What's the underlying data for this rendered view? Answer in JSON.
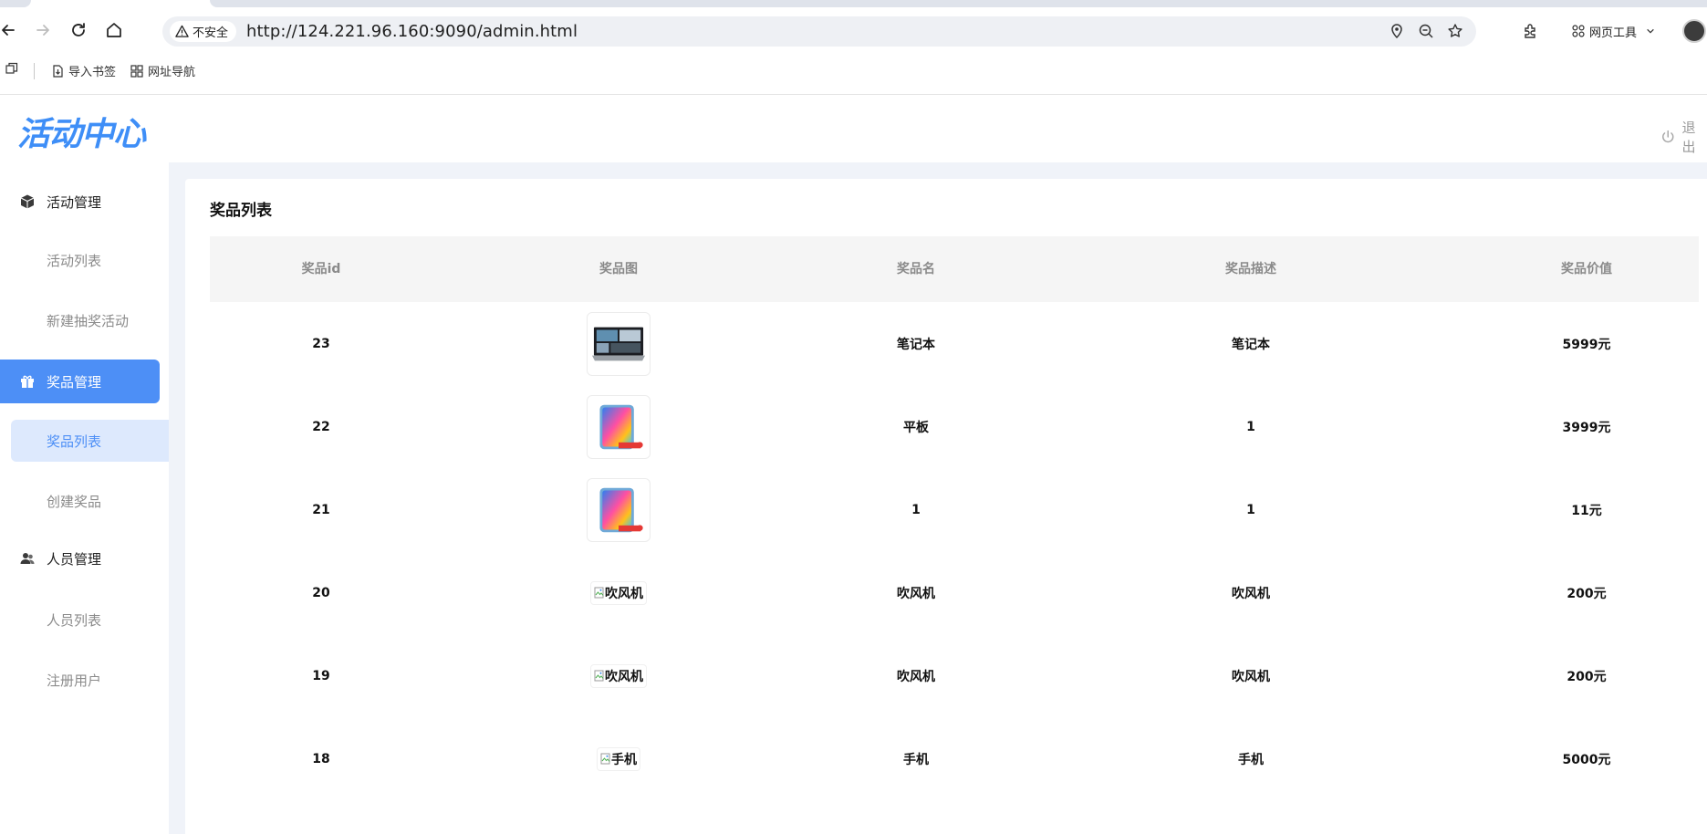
{
  "browser": {
    "security_label": "不安全",
    "url": "http://124.221.96.160:9090/admin.html",
    "web_tools_label": "网页工具",
    "bookmarks": [
      {
        "label": "导入书签",
        "icon": "import-bookmark-icon"
      },
      {
        "label": "网址导航",
        "icon": "grid-icon"
      }
    ]
  },
  "app": {
    "logo_text": "活动中心",
    "logout_label": "退出",
    "accent_color": "#4d8ff6"
  },
  "sidebar": {
    "groups": [
      {
        "label": "活动管理",
        "icon": "cube-icon",
        "items": [
          "活动列表",
          "新建抽奖活动"
        ]
      },
      {
        "label": "奖品管理",
        "icon": "gift-icon",
        "items": [
          "奖品列表",
          "创建奖品"
        ]
      },
      {
        "label": "人员管理",
        "icon": "users-icon",
        "items": [
          "人员列表",
          "注册用户"
        ]
      }
    ],
    "active_group": "奖品管理",
    "active_item": "奖品列表"
  },
  "page": {
    "title": "奖品列表"
  },
  "table": {
    "columns": [
      "奖品id",
      "奖品图",
      "奖品名",
      "奖品描述",
      "奖品价值"
    ],
    "rows": [
      {
        "id": "23",
        "image": "laptop",
        "image_alt": "",
        "name": "笔记本",
        "desc": "笔记本",
        "value": "5999元"
      },
      {
        "id": "22",
        "image": "tablet",
        "image_alt": "",
        "name": "平板",
        "desc": "1",
        "value": "3999元"
      },
      {
        "id": "21",
        "image": "tablet",
        "image_alt": "",
        "name": "1",
        "desc": "1",
        "value": "11元"
      },
      {
        "id": "20",
        "image": "broken",
        "image_alt": "吹风机",
        "name": "吹风机",
        "desc": "吹风机",
        "value": "200元"
      },
      {
        "id": "19",
        "image": "broken",
        "image_alt": "吹风机",
        "name": "吹风机",
        "desc": "吹风机",
        "value": "200元"
      },
      {
        "id": "18",
        "image": "broken",
        "image_alt": "手机",
        "name": "手机",
        "desc": "手机",
        "value": "5000元"
      }
    ]
  }
}
